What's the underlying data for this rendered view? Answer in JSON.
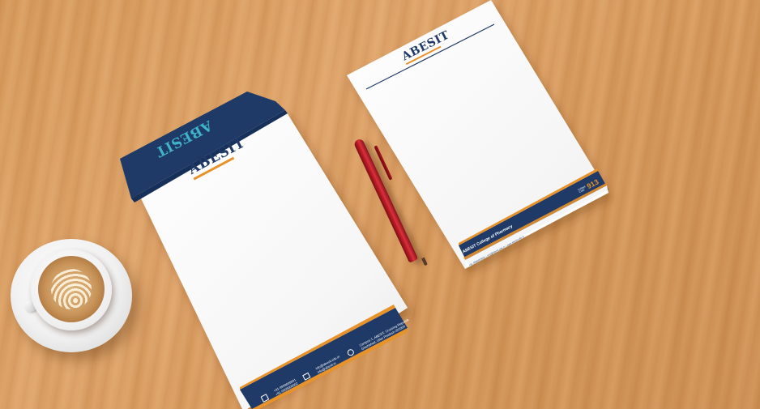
{
  "envelope": {
    "logo_text": "ABESIT",
    "flap_logo_text": "ABESIT",
    "footer_phone_1": "+91-9999000001",
    "footer_phone_2": "+91-9999000002",
    "footer_email_1": "info@abesit.edu.in",
    "footer_email_2": "info@abesit.in",
    "footer_address_1": "Campus 1, ABESIT, Crossing Republik",
    "footer_address_2": "Ghaziabad, Uttar Pradesh 201009"
  },
  "letterhead": {
    "logo_text": "ABESIT",
    "college_name": "ABESIT College of Pharmacy",
    "college_code_label": "College Code",
    "college_code": "913",
    "contact_line": "+91-9999000001 | info@abesit.edu.in | www.abesit.edu.in"
  },
  "colors": {
    "navy": "#1f3a66",
    "orange": "#e8922a",
    "paper": "#ffffff",
    "wood": "#d89a5a",
    "pen": "#c11d28"
  }
}
